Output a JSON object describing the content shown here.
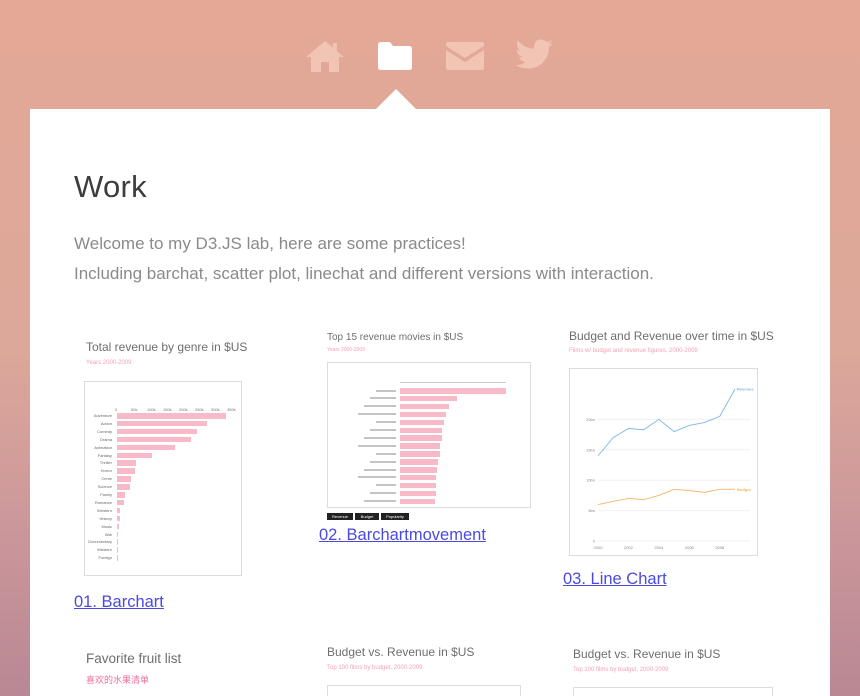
{
  "nav": {
    "icons": [
      "home-icon",
      "folder-icon",
      "mail-icon",
      "twitter-icon"
    ],
    "active": "folder-icon"
  },
  "page": {
    "title": "Work",
    "intro_line1": "Welcome to my D3.JS lab, here are some practices!",
    "intro_line2": "Including barchat, scatter plot, linechat and different versions with interaction."
  },
  "colors": {
    "accent_link": "#4a4ae0",
    "bar_pink": "#f8b9c9",
    "line_blue": "#7db7ea",
    "line_orange": "#f6b46a"
  },
  "cards": {
    "c1": {
      "title": "Total revenue by genre in $US",
      "subtitle": "Years 2000-2009",
      "link": "01. Barchart",
      "ticks": [
        "0",
        "50k",
        "100k",
        "150k",
        "200k",
        "250k",
        "300k",
        "350k"
      ]
    },
    "c2": {
      "title": "Top 15 revenue movies in $US",
      "subtitle": "Years 2000-2009",
      "link": "02. Barchartmovement",
      "buttons": [
        "Revenue",
        "Budget",
        "Popularity"
      ]
    },
    "c3": {
      "title": "Budget and Revenue over time in $US",
      "subtitle": "Films w/ budget and revenue figures, 2000-2009",
      "link": "03. Line Chart",
      "series_labels": [
        "Revenue",
        "Budget"
      ],
      "y_ticks": [
        "20bn",
        "15bn",
        "10bn",
        "5bn",
        "0"
      ],
      "x_ticks": [
        "2000",
        "2002",
        "2004",
        "2006",
        "2008"
      ]
    },
    "c4": {
      "title": "Favorite fruit list",
      "subtitle": "喜欢的水果清单"
    },
    "c5": {
      "title": "Budget vs. Revenue in $US",
      "subtitle": "Top 100 films by budget, 2000-2009"
    },
    "c6": {
      "title": "Budget vs. Revenue in $US",
      "subtitle": "Top 100 films by budget, 2000-2009"
    }
  },
  "chart_data": [
    {
      "type": "bar",
      "title": "Total revenue by genre in $US",
      "subtitle": "Years 2000-2009",
      "orientation": "horizontal",
      "categories": [
        "Adventure",
        "Action",
        "Comedy",
        "Drama",
        "Animation",
        "Fantasy",
        "Thriller",
        "Horror",
        "Crime",
        "Science",
        "Family",
        "Romance",
        "Western",
        "History",
        "Music",
        "War",
        "Documentary",
        "Western",
        "Foreign"
      ],
      "values": [
        340,
        280,
        250,
        230,
        180,
        110,
        60,
        55,
        45,
        42,
        25,
        22,
        10,
        8,
        6,
        4,
        2,
        1,
        0.5
      ],
      "xlim": [
        0,
        350
      ]
    },
    {
      "type": "bar",
      "title": "Top 15 revenue movies in $US",
      "subtitle": "Years 2000-2009",
      "orientation": "horizontal",
      "values": [
        2.8,
        1.5,
        1.3,
        1.2,
        1.15,
        1.1,
        1.1,
        1.05,
        1.05,
        1.0,
        0.98,
        0.96,
        0.95,
        0.94,
        0.93
      ]
    },
    {
      "type": "line",
      "title": "Budget and Revenue over time in $US",
      "subtitle": "Films w/ budget and revenue figures, 2000-2009",
      "x": [
        2000,
        2001,
        2002,
        2003,
        2004,
        2005,
        2006,
        2007,
        2008,
        2009
      ],
      "series": [
        {
          "name": "Revenue",
          "values": [
            14,
            17,
            18.5,
            18.3,
            20,
            18,
            19,
            19.5,
            20.5,
            25
          ]
        },
        {
          "name": "Budget",
          "values": [
            6,
            6.5,
            7,
            6.8,
            7.5,
            8.5,
            8.3,
            8,
            8.5,
            8.5
          ]
        }
      ],
      "ylim": [
        0,
        25
      ]
    }
  ]
}
